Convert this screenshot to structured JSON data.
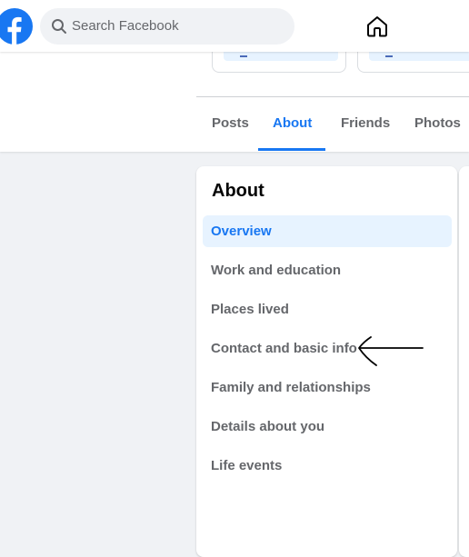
{
  "search": {
    "placeholder": "Search Facebook"
  },
  "icons": {
    "logo": "facebook-logo",
    "search": "search-icon",
    "home": "home-icon",
    "brand_color": "#1877f2"
  },
  "profile_tabs": [
    {
      "label": "Posts",
      "active": false
    },
    {
      "label": "About",
      "active": true
    },
    {
      "label": "Friends",
      "active": false
    },
    {
      "label": "Photos",
      "active": false
    }
  ],
  "about": {
    "title": "About",
    "items": [
      {
        "label": "Overview",
        "selected": true
      },
      {
        "label": "Work and education",
        "selected": false
      },
      {
        "label": "Places lived",
        "selected": false
      },
      {
        "label": "Contact and basic info",
        "selected": false
      },
      {
        "label": "Family and relationships",
        "selected": false
      },
      {
        "label": "Details about you",
        "selected": false
      },
      {
        "label": "Life events",
        "selected": false
      }
    ]
  },
  "annotation": {
    "type": "hand-drawn-arrow",
    "points_to": "Contact and basic info"
  }
}
